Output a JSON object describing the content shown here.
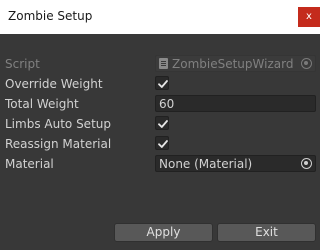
{
  "window": {
    "title": "Zombie Setup",
    "close_glyph": "x"
  },
  "fields": {
    "script": {
      "label": "Script",
      "value": "ZombieSetupWizard",
      "icon": "script-file-icon"
    },
    "override_weight": {
      "label": "Override Weight",
      "checked": true
    },
    "total_weight": {
      "label": "Total Weight",
      "value": "60"
    },
    "limbs_auto_setup": {
      "label": "Limbs Auto Setup",
      "checked": true
    },
    "reassign_material": {
      "label": "Reassign Material",
      "checked": true
    },
    "material": {
      "label": "Material",
      "value": "None (Material)",
      "icon": "object-picker-icon"
    }
  },
  "buttons": {
    "apply": "Apply",
    "exit": "Exit"
  },
  "colors": {
    "background": "#383838",
    "titlebar": "#ffffff",
    "close": "#c42b1c",
    "field": "#2a2a2a",
    "button": "#585858"
  }
}
